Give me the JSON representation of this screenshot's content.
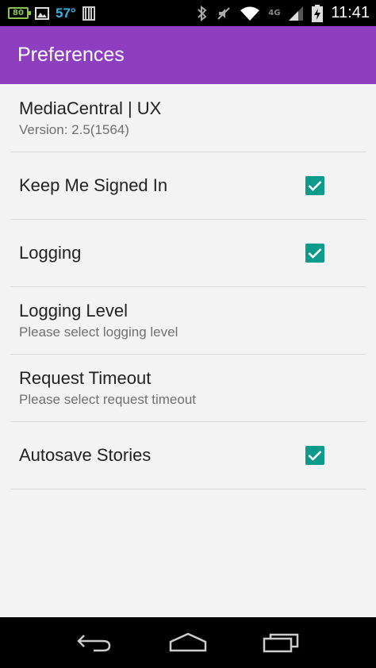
{
  "status_bar": {
    "battery_level": "80",
    "temperature": "57°",
    "network_label": "4G",
    "time": "11:41",
    "icons": [
      "battery-icon",
      "image-icon",
      "barcode-icon",
      "bluetooth-icon",
      "mute-icon",
      "wifi-icon",
      "signal-icon",
      "charging-battery-icon"
    ]
  },
  "app_bar": {
    "title": "Preferences",
    "color": "#8e3fc0"
  },
  "preferences": {
    "about": {
      "title": "MediaCentral | UX",
      "summary": "Version: 2.5(1564)"
    },
    "keep_signed_in": {
      "title": "Keep Me Signed In",
      "checked": true
    },
    "logging": {
      "title": "Logging",
      "checked": true
    },
    "logging_level": {
      "title": "Logging Level",
      "summary": "Please select logging level"
    },
    "request_timeout": {
      "title": "Request Timeout",
      "summary": "Please select request timeout"
    },
    "autosave": {
      "title": "Autosave Stories",
      "checked": true
    }
  },
  "accent_color": "#0c9a8b",
  "nav_bar": {
    "icons": [
      "back-icon",
      "home-icon",
      "recents-icon"
    ]
  }
}
